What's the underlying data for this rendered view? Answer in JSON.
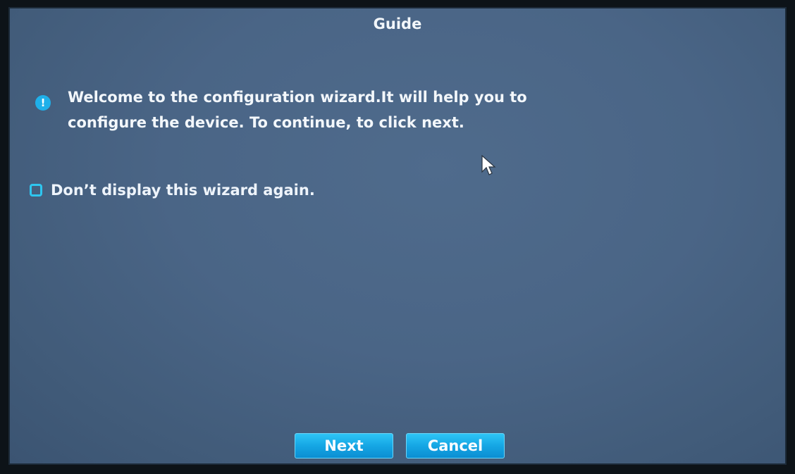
{
  "dialog": {
    "title": "Guide",
    "info_icon": "info-icon",
    "message": "Welcome to the configuration wizard.It will help you to\nconfigure the device. To continue, to click next.",
    "checkbox_label": "Don’t display this wizard again.",
    "checkbox_checked": false,
    "next_label": "Next",
    "cancel_label": "Cancel"
  },
  "colors": {
    "dialog_bg": "#4a6586",
    "accent": "#1fb0ea",
    "button": "#15a6e4",
    "text": "#eef4fb"
  }
}
